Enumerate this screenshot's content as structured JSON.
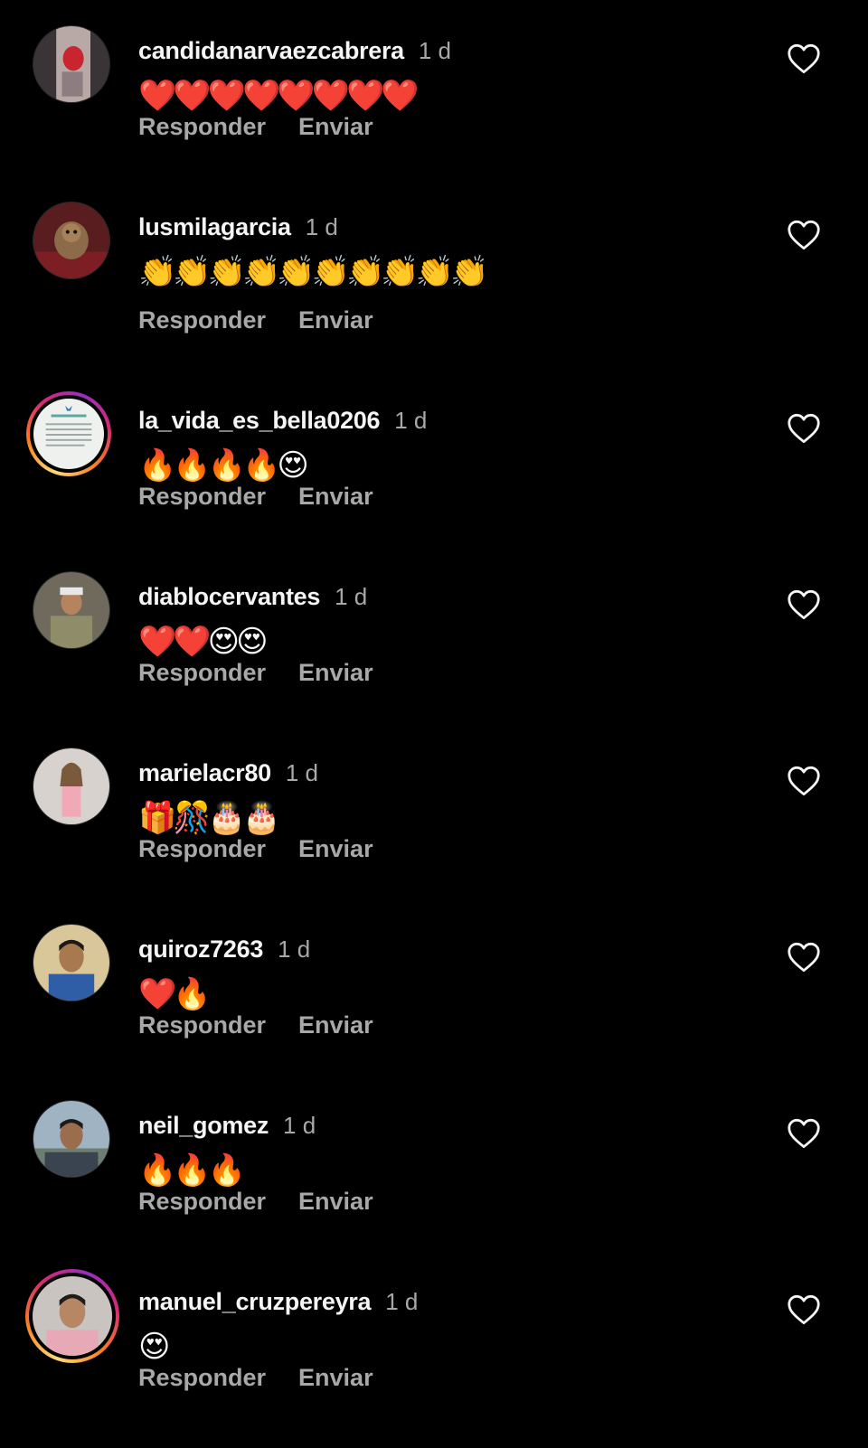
{
  "colors": {
    "background": "#000000",
    "username": "#f5f5f5",
    "secondary_text": "#a8a8a8",
    "story_ring": "#d62976"
  },
  "comments": [
    {
      "username": "candidanarvaezcabrera",
      "time": "1 d",
      "text": "❤️❤️❤️❤️❤️❤️❤️❤️",
      "reply_label": "Responder",
      "send_label": "Enviar",
      "avatar_icon": "avatar-photo",
      "has_story_ring": false,
      "like_icon": "heart-outline-icon"
    },
    {
      "username": "lusmilagarcia",
      "time": "1 d",
      "text": "👏👏👏👏👏👏👏👏👏👏",
      "reply_label": "Responder",
      "send_label": "Enviar",
      "avatar_icon": "avatar-photo",
      "has_story_ring": false,
      "like_icon": "heart-outline-icon"
    },
    {
      "username": "la_vida_es_bella0206",
      "time": "1 d",
      "text": "🔥🔥🔥🔥😍",
      "reply_label": "Responder",
      "send_label": "Enviar",
      "avatar_icon": "avatar-photo",
      "has_story_ring": true,
      "like_icon": "heart-outline-icon"
    },
    {
      "username": "diablocervantes",
      "time": "1 d",
      "text": "❤️❤️😍😍",
      "reply_label": "Responder",
      "send_label": "Enviar",
      "avatar_icon": "avatar-photo",
      "has_story_ring": false,
      "like_icon": "heart-outline-icon"
    },
    {
      "username": "marielacr80",
      "time": "1 d",
      "text": "🎁🎊🎂🎂",
      "reply_label": "Responder",
      "send_label": "Enviar",
      "avatar_icon": "avatar-photo",
      "has_story_ring": false,
      "like_icon": "heart-outline-icon"
    },
    {
      "username": "quiroz7263",
      "time": "1 d",
      "text": "❤️🔥",
      "reply_label": "Responder",
      "send_label": "Enviar",
      "avatar_icon": "avatar-photo",
      "has_story_ring": false,
      "like_icon": "heart-outline-icon"
    },
    {
      "username": "neil_gomez",
      "time": "1 d",
      "text": "🔥🔥🔥",
      "reply_label": "Responder",
      "send_label": "Enviar",
      "avatar_icon": "avatar-photo",
      "has_story_ring": false,
      "like_icon": "heart-outline-icon"
    },
    {
      "username": "manuel_cruzpereyra",
      "time": "1 d",
      "text": "😍",
      "reply_label": "Responder",
      "send_label": "Enviar",
      "avatar_icon": "avatar-photo",
      "has_story_ring": true,
      "like_icon": "heart-outline-icon"
    }
  ]
}
